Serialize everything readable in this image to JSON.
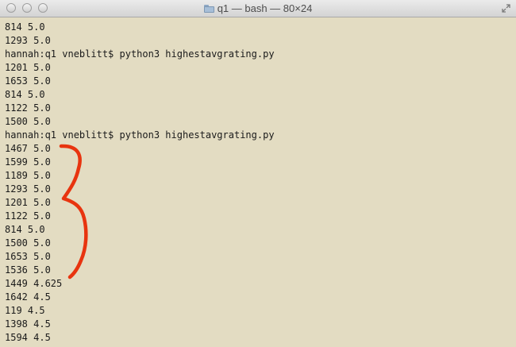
{
  "window": {
    "title": "q1 — bash — 80×24"
  },
  "terminal": {
    "lines": [
      "814 5.0",
      "1293 5.0",
      "hannah:q1 vneblitt$ python3 highestavgrating.py",
      "1201 5.0",
      "1653 5.0",
      "814 5.0",
      "1122 5.0",
      "1500 5.0",
      "hannah:q1 vneblitt$ python3 highestavgrating.py",
      "1467 5.0",
      "1599 5.0",
      "1189 5.0",
      "1293 5.0",
      "1201 5.0",
      "1122 5.0",
      "814 5.0",
      "1500 5.0",
      "1653 5.0",
      "1536 5.0",
      "1449 4.625",
      "1642 4.5",
      "119 4.5",
      "1398 4.5",
      "1594 4.5"
    ]
  },
  "annotation": {
    "color": "#e8340f"
  }
}
